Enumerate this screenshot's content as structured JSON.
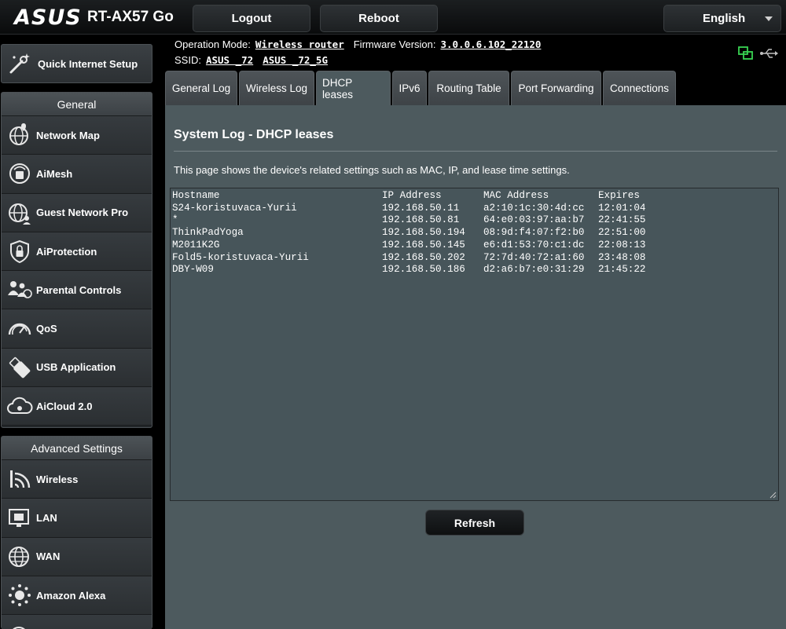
{
  "header": {
    "brand": "ASUS",
    "model": "RT-AX57 Go",
    "logout_label": "Logout",
    "reboot_label": "Reboot",
    "language": "English"
  },
  "info": {
    "operation_mode_label": "Operation Mode:",
    "operation_mode_value": "Wireless router",
    "firmware_label": "Firmware Version:",
    "firmware_value": "3.0.0.6.102_22120",
    "ssid_label": "SSID:",
    "ssid_values": [
      "ASUS _72",
      "ASUS _72_5G"
    ]
  },
  "sidebar": {
    "quick_setup_label": "Quick Internet Setup",
    "general_heading": "General",
    "general_items": [
      {
        "label": "Network Map",
        "icon": "globe-icon"
      },
      {
        "label": "AiMesh",
        "icon": "aimesh-icon"
      },
      {
        "label": "Guest Network Pro",
        "icon": "guest-network-icon"
      },
      {
        "label": "AiProtection",
        "icon": "shield-lock-icon"
      },
      {
        "label": "Parental Controls",
        "icon": "family-icon"
      },
      {
        "label": "QoS",
        "icon": "speedometer-icon"
      },
      {
        "label": "USB Application",
        "icon": "usb-icon"
      },
      {
        "label": "AiCloud 2.0",
        "icon": "cloud-icon"
      }
    ],
    "advanced_heading": "Advanced Settings",
    "advanced_items": [
      {
        "label": "Wireless",
        "icon": "wifi-icon"
      },
      {
        "label": "LAN",
        "icon": "lan-icon"
      },
      {
        "label": "WAN",
        "icon": "wan-globe-icon"
      },
      {
        "label": "Amazon Alexa",
        "icon": "alexa-icon"
      }
    ]
  },
  "tabs": [
    {
      "label": "General Log",
      "active": false
    },
    {
      "label": "Wireless Log",
      "active": false
    },
    {
      "label": "DHCP leases",
      "active": true
    },
    {
      "label": "IPv6",
      "active": false
    },
    {
      "label": "Routing Table",
      "active": false
    },
    {
      "label": "Port Forwarding",
      "active": false
    },
    {
      "label": "Connections",
      "active": false
    }
  ],
  "main": {
    "title": "System Log - DHCP leases",
    "description": "This page shows the device's related settings such as MAC, IP, and lease time settings.",
    "columns": [
      "Hostname",
      "IP Address",
      "MAC Address",
      "Expires"
    ],
    "rows": [
      [
        "S24-koristuvaca-Yurii",
        "192.168.50.11",
        "a2:10:1c:30:4d:cc",
        "12:01:04"
      ],
      [
        "*",
        "192.168.50.81",
        "64:e0:03:97:aa:b7",
        "22:41:55"
      ],
      [
        "ThinkPadYoga",
        "192.168.50.194",
        "08:9d:f4:07:f2:b0",
        "22:51:00"
      ],
      [
        "M2011K2G",
        "192.168.50.145",
        "e6:d1:53:70:c1:dc",
        "22:08:13"
      ],
      [
        "Fold5-koristuvaca-Yurii",
        "192.168.50.202",
        "72:7d:40:72:a1:60",
        "23:48:08"
      ],
      [
        "DBY-W09",
        "192.168.50.186",
        "d2:a6:b7:e0:31:29",
        "21:45:22"
      ]
    ],
    "refresh_label": "Refresh"
  },
  "colors": {
    "panel_bg": "#4d5a5e",
    "log_bg": "#47555a",
    "status_green": "#39d353"
  }
}
